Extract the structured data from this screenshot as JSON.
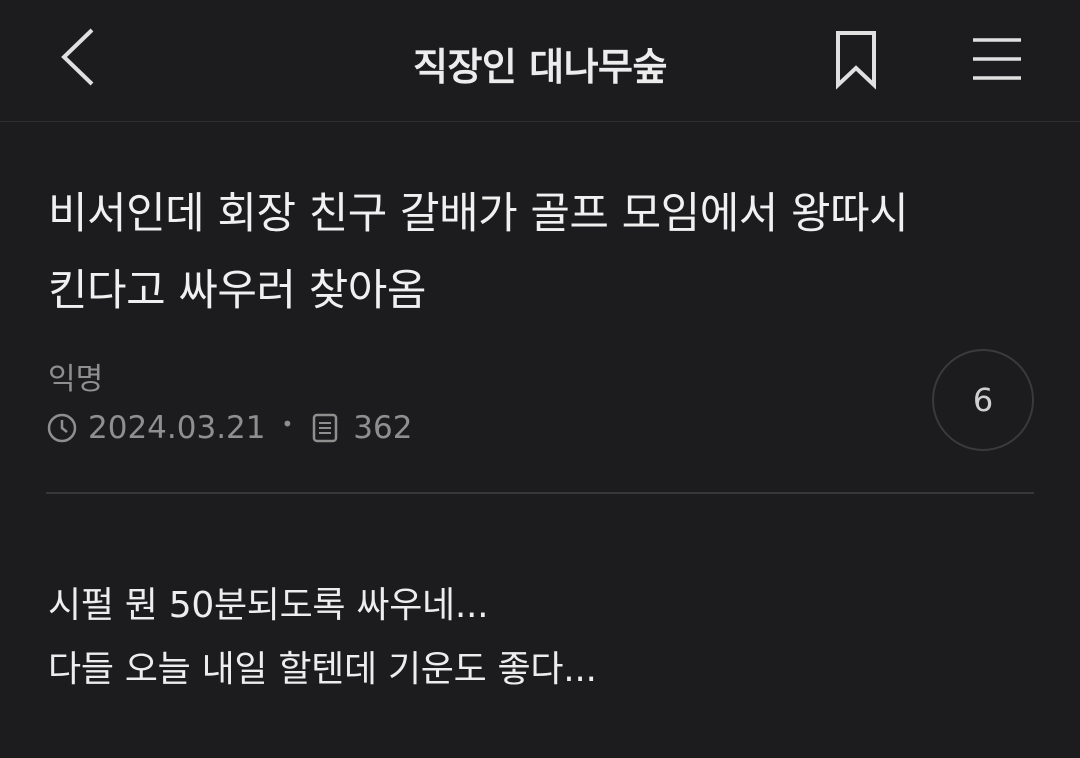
{
  "header": {
    "title": "직장인 대나무숲",
    "back_icon": "chevron-left-icon",
    "bookmark_icon": "bookmark-icon",
    "menu_icon": "hamburger-menu-icon"
  },
  "post": {
    "title_line1": "비서인데 회장 친구 갈배가 골프 모임에서 왕따시",
    "title_line2": "킨다고 싸우러 찾아옴",
    "author": "익명",
    "date": "2024.03.21",
    "views": "362",
    "comment_count": "6",
    "body": [
      "시펄 뭔 50분되도록 싸우네...",
      "다들 오늘 내일 할텐데 기운도 좋다..."
    ]
  },
  "colors": {
    "background": "#1c1c1e",
    "text_primary": "#ededed",
    "text_secondary": "#8f8f8f",
    "divider": "#38383a"
  }
}
